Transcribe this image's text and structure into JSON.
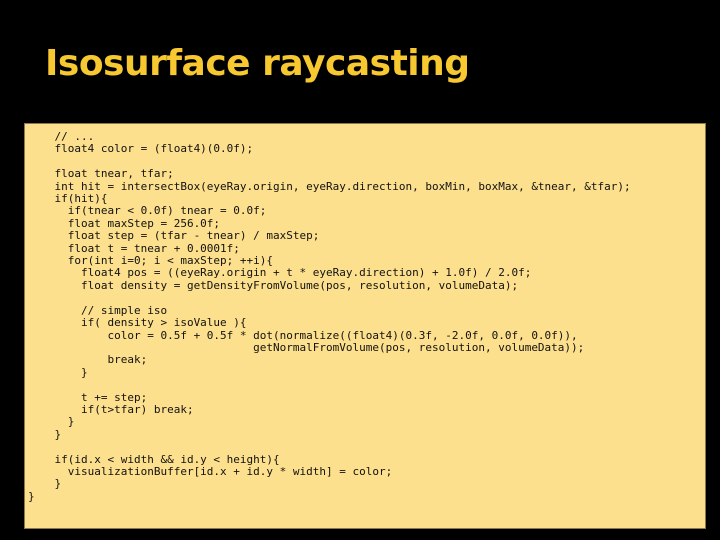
{
  "slide": {
    "title": "Isosurface raycasting"
  },
  "code": {
    "text": "    // ...\n    float4 color = (float4)(0.0f);\n\n    float tnear, tfar;\n    int hit = intersectBox(eyeRay.origin, eyeRay.direction, boxMin, boxMax, &tnear, &tfar);\n    if(hit){\n      if(tnear < 0.0f) tnear = 0.0f;\n      float maxStep = 256.0f;\n      float step = (tfar - tnear) / maxStep;\n      float t = tnear + 0.0001f;\n      for(int i=0; i < maxStep; ++i){\n        float4 pos = ((eyeRay.origin + t * eyeRay.direction) + 1.0f) / 2.0f;\n        float density = getDensityFromVolume(pos, resolution, volumeData);\n\n        // simple iso\n        if( density > isoValue ){\n            color = 0.5f + 0.5f * dot(normalize((float4)(0.3f, -2.0f, 0.0f, 0.0f)),\n                                  getNormalFromVolume(pos, resolution, volumeData));\n            break;\n        }\n\n        t += step;\n        if(t>tfar) break;\n      }\n    }\n\n    if(id.x < width && id.y < height){\n      visualizationBuffer[id.x + id.y * width] = color;\n    }\n}"
  }
}
